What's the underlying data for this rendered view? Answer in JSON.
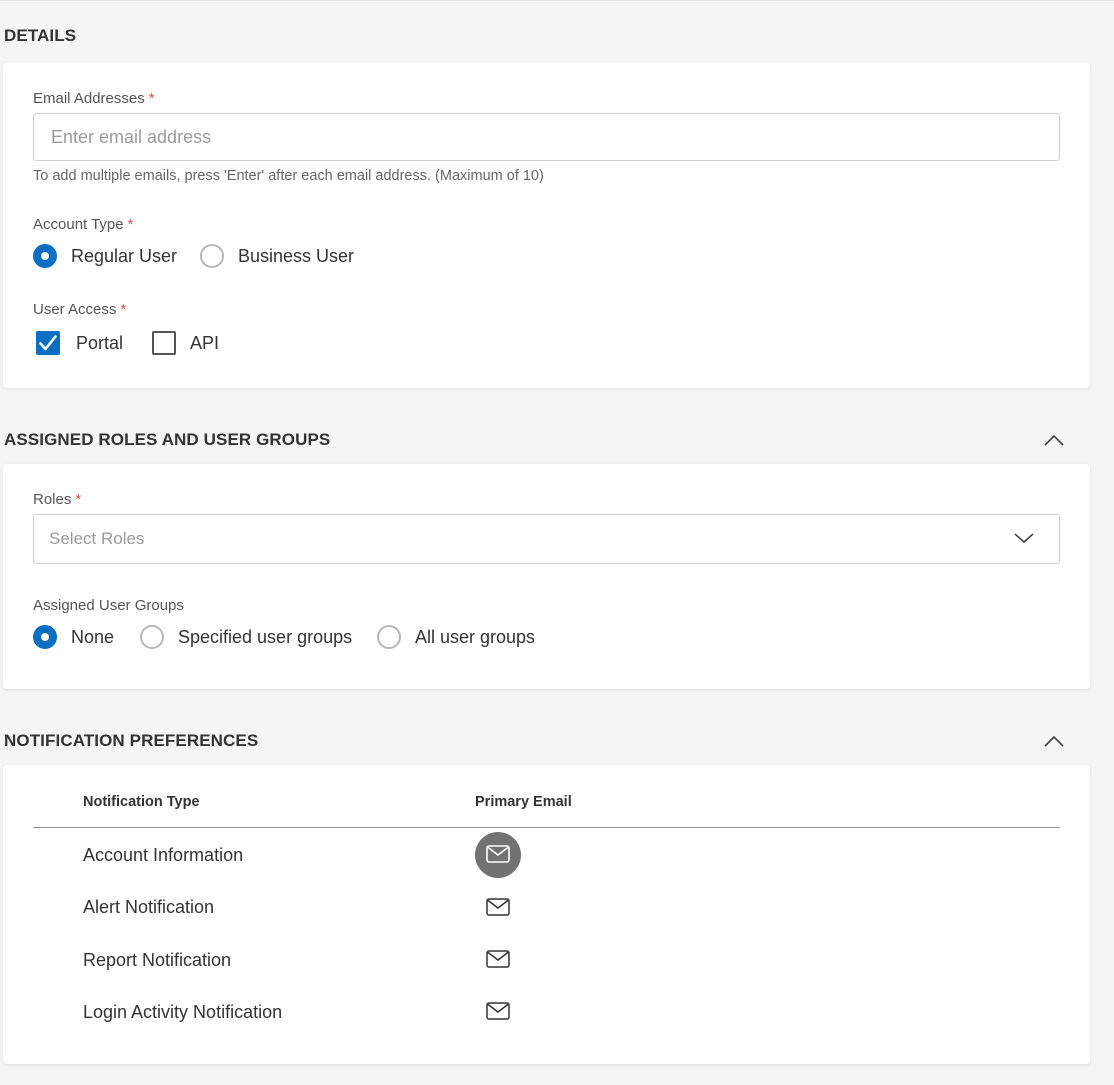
{
  "details": {
    "title": "DETAILS",
    "email": {
      "label": "Email Addresses",
      "required_mark": "*",
      "placeholder": "Enter email address",
      "value": "",
      "hint": "To add multiple emails, press 'Enter' after each email address. (Maximum of 10)"
    },
    "account_type": {
      "label": "Account Type",
      "required_mark": "*",
      "options": [
        {
          "label": "Regular User",
          "selected": true
        },
        {
          "label": "Business User",
          "selected": false
        }
      ]
    },
    "user_access": {
      "label": "User Access",
      "required_mark": "*",
      "options": [
        {
          "label": "Portal",
          "checked": true
        },
        {
          "label": "API",
          "checked": false
        }
      ]
    }
  },
  "roles_section": {
    "title": "ASSIGNED ROLES AND USER GROUPS",
    "collapse_icon": "chevron-up-icon",
    "roles": {
      "label": "Roles",
      "required_mark": "*",
      "placeholder": "Select Roles",
      "icon": "chevron-down-icon"
    },
    "user_groups": {
      "label": "Assigned User Groups",
      "options": [
        {
          "label": "None",
          "selected": true
        },
        {
          "label": "Specified user groups",
          "selected": false
        },
        {
          "label": "All user groups",
          "selected": false
        }
      ]
    }
  },
  "notifications": {
    "title": "NOTIFICATION PREFERENCES",
    "collapse_icon": "chevron-up-icon",
    "columns": [
      "Notification Type",
      "Primary Email"
    ],
    "rows": [
      {
        "type": "Account Information",
        "icon": "mail-icon",
        "highlighted": true
      },
      {
        "type": "Alert Notification",
        "icon": "mail-icon",
        "highlighted": false
      },
      {
        "type": "Report Notification",
        "icon": "mail-icon",
        "highlighted": false
      },
      {
        "type": "Login Activity Notification",
        "icon": "mail-icon",
        "highlighted": false
      }
    ]
  },
  "colors": {
    "accent": "#0a6fc2",
    "required": "#d9534f",
    "page_background": "#f5f5f5",
    "card_background": "#ffffff",
    "highlight_circle": "#727272"
  }
}
